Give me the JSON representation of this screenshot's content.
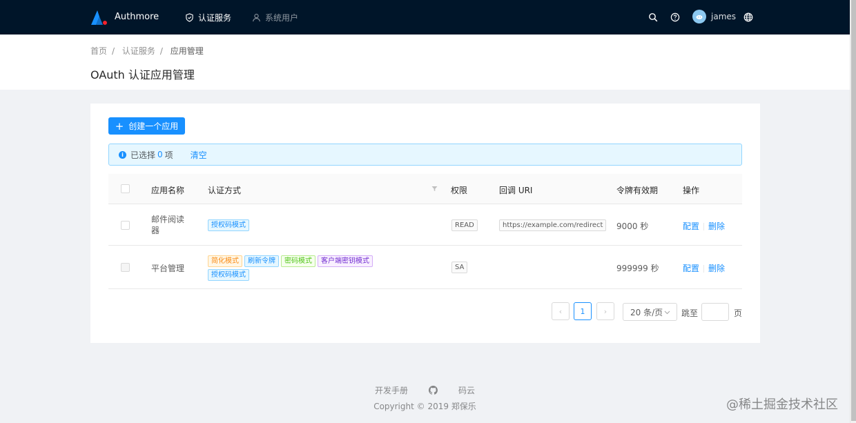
{
  "header": {
    "brand": "Authmore",
    "nav": [
      {
        "label": "认证服务",
        "active": true
      },
      {
        "label": "系统用户",
        "active": false
      }
    ],
    "user": "james"
  },
  "breadcrumb": [
    "首页",
    "认证服务",
    "应用管理"
  ],
  "page_title": "OAuth 认证应用管理",
  "actions": {
    "create_label": "创建一个应用"
  },
  "alert": {
    "prefix": "已选择",
    "count": "0",
    "suffix": "项",
    "clear": "清空"
  },
  "table": {
    "columns": [
      "应用名称",
      "认证方式",
      "权限",
      "回调 URI",
      "令牌有效期",
      "操作"
    ],
    "rows": [
      {
        "name": "邮件阅读器",
        "grants": [
          {
            "label": "授权码模式",
            "color": "blue"
          }
        ],
        "scope": "READ",
        "redirect_uri": "https://example.com/redirect",
        "validity": "9000 秒",
        "ops": [
          "配置",
          "删除"
        ],
        "checkbox_disabled": false
      },
      {
        "name": "平台管理",
        "grants": [
          {
            "label": "简化模式",
            "color": "orange"
          },
          {
            "label": "刷新令牌",
            "color": "blue"
          },
          {
            "label": "密码模式",
            "color": "green"
          },
          {
            "label": "客户端密钥模式",
            "color": "purple"
          },
          {
            "label": "授权码模式",
            "color": "blue"
          }
        ],
        "scope": "SA",
        "redirect_uri": "",
        "validity": "999999 秒",
        "ops": [
          "配置",
          "删除"
        ],
        "checkbox_disabled": true
      }
    ]
  },
  "pagination": {
    "current": "1",
    "page_size": "20 条/页",
    "jump_label": "跳至",
    "page_unit": "页",
    "jump_value": ""
  },
  "footer": {
    "links": [
      "开发手册",
      "码云"
    ],
    "copyright": "Copyright © 2019 郑保乐"
  },
  "watermark": "@稀土掘金技术社区",
  "colors": {
    "header_bg": "#001529",
    "primary": "#1890ff",
    "page_bg": "#f0f2f5"
  }
}
